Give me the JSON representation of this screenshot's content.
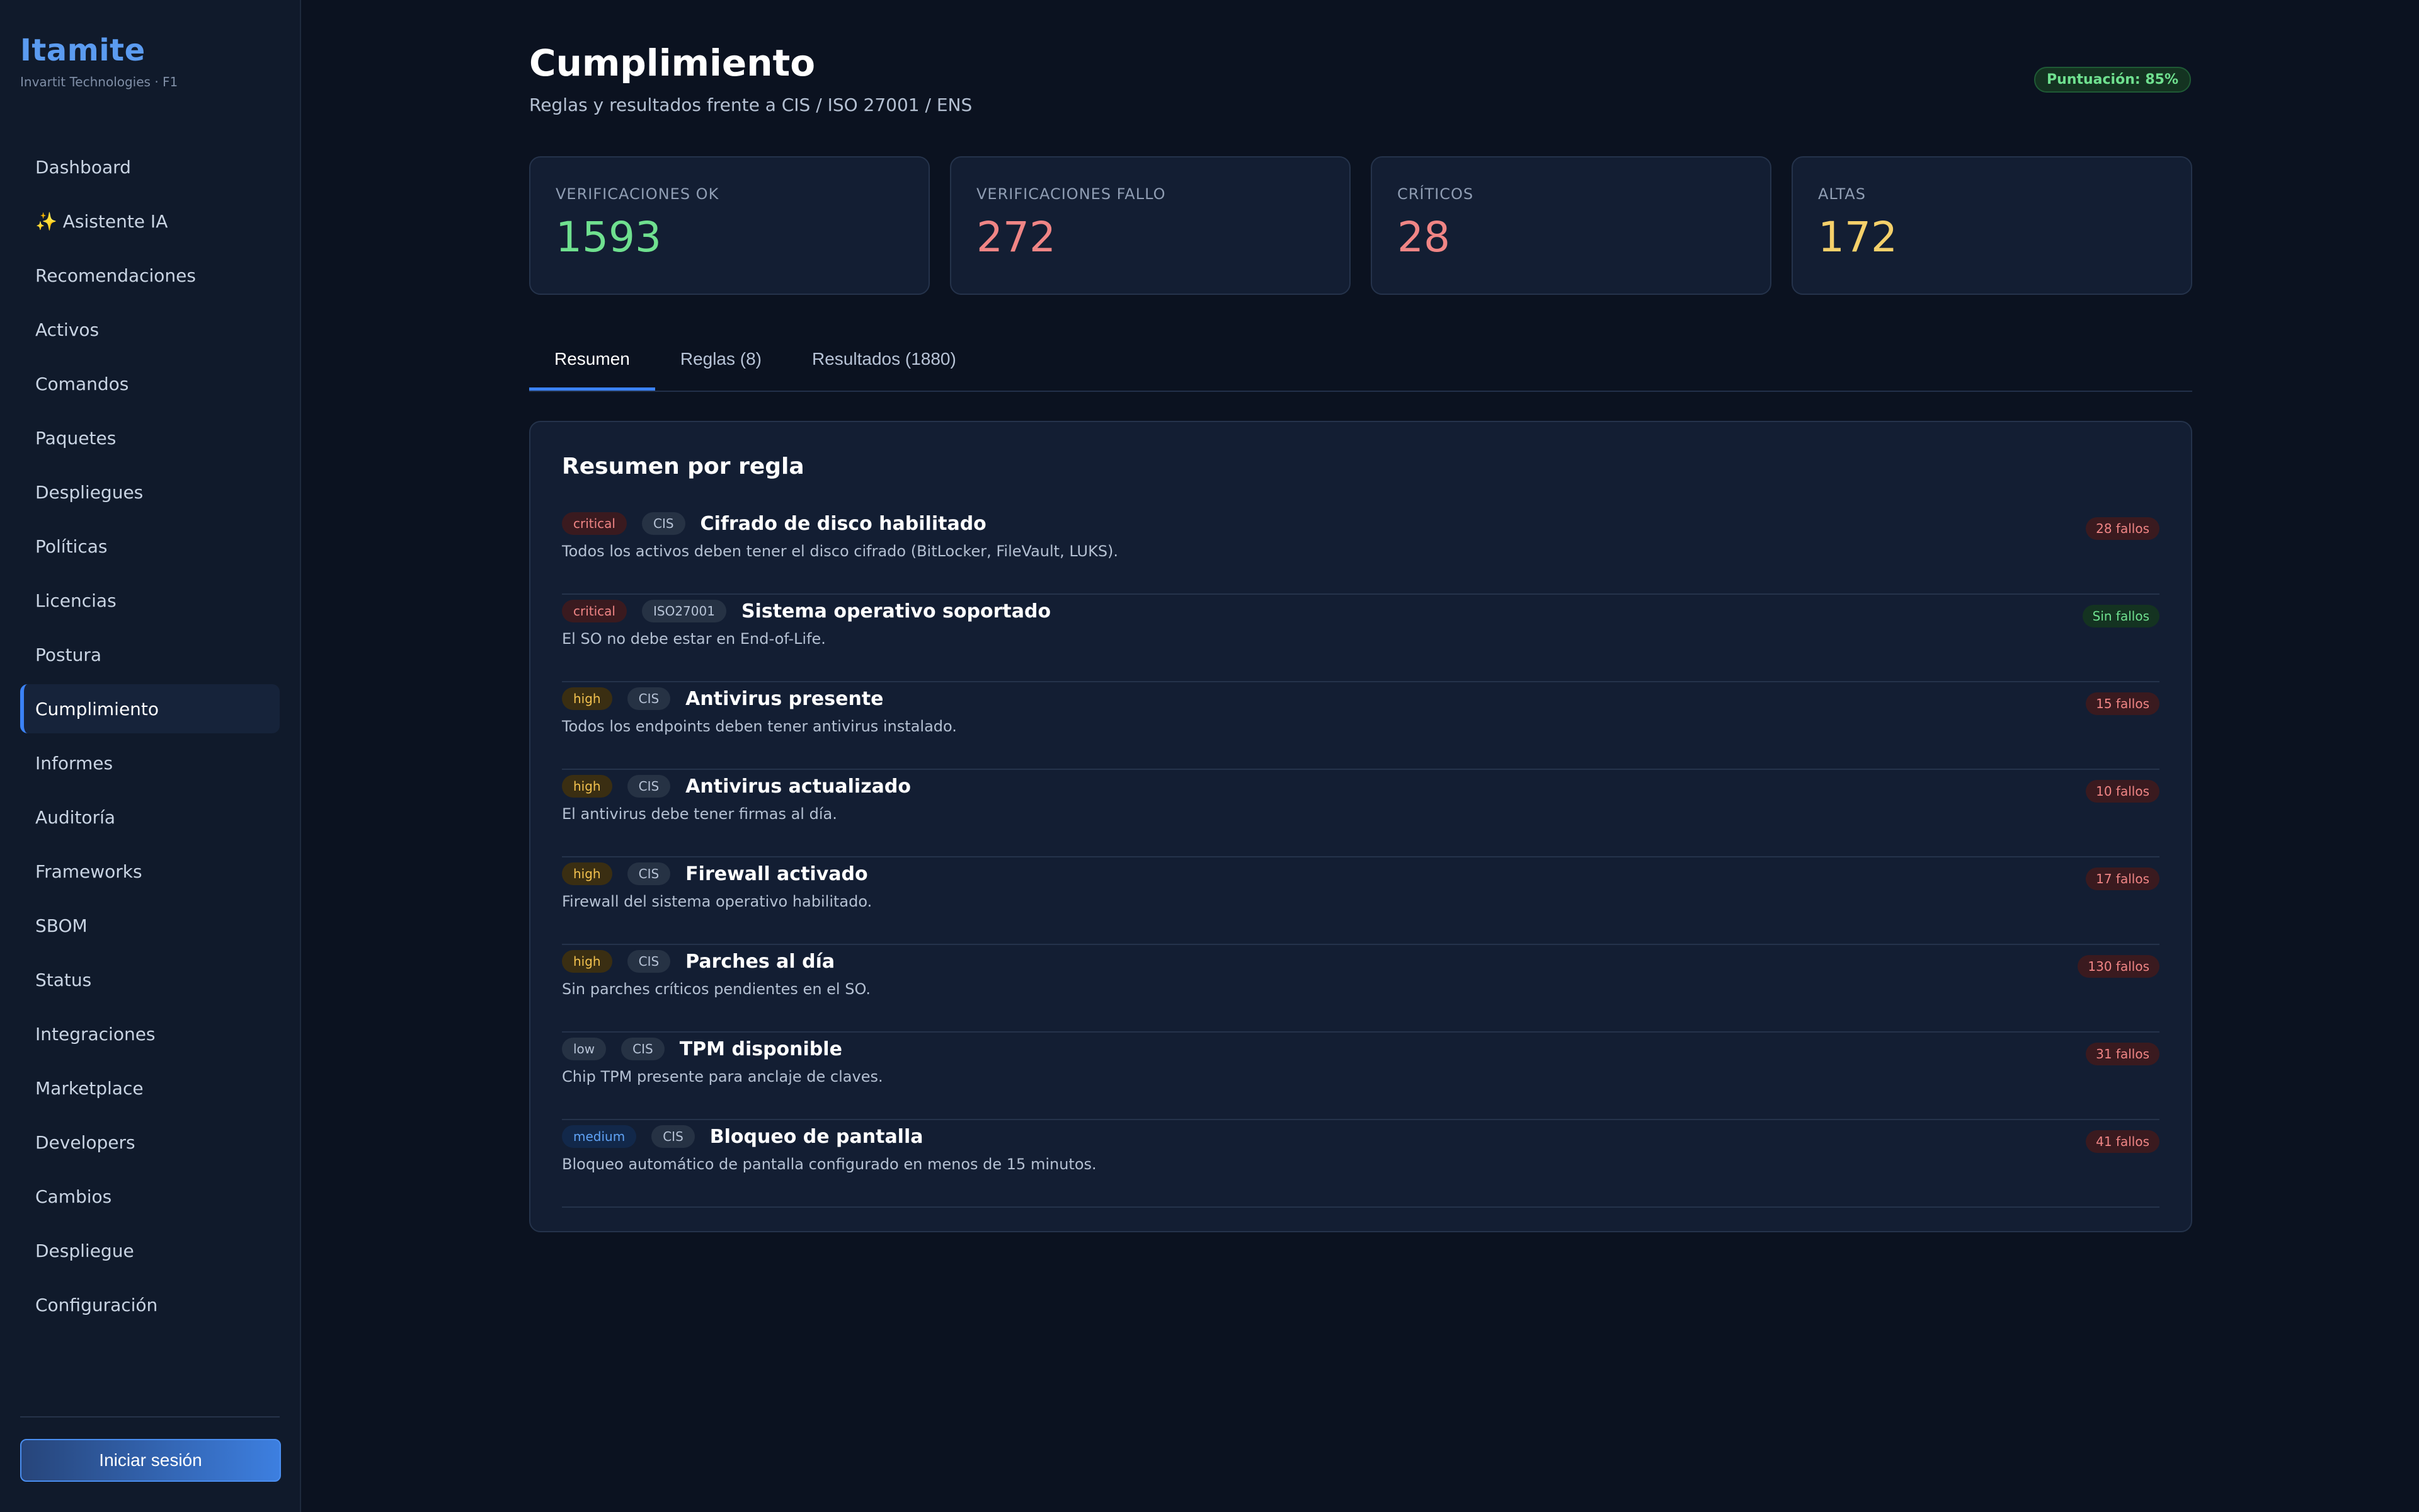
{
  "brand": {
    "title": "Itamite",
    "subtitle": "Invartit Technologies · F1"
  },
  "sidebar": {
    "items": [
      {
        "label": "Dashboard"
      },
      {
        "label": "✨ Asistente IA"
      },
      {
        "label": "Recomendaciones"
      },
      {
        "label": "Activos"
      },
      {
        "label": "Comandos"
      },
      {
        "label": "Paquetes"
      },
      {
        "label": "Despliegues"
      },
      {
        "label": "Políticas"
      },
      {
        "label": "Licencias"
      },
      {
        "label": "Postura"
      },
      {
        "label": "Cumplimiento"
      },
      {
        "label": "Informes"
      },
      {
        "label": "Auditoría"
      },
      {
        "label": "Frameworks"
      },
      {
        "label": "SBOM"
      },
      {
        "label": "Status"
      },
      {
        "label": "Integraciones"
      },
      {
        "label": "Marketplace"
      },
      {
        "label": "Developers"
      },
      {
        "label": "Cambios"
      },
      {
        "label": "Despliegue"
      },
      {
        "label": "Configuración"
      }
    ],
    "active_index": 10,
    "login_label": "Iniciar sesión"
  },
  "header": {
    "title": "Cumplimiento",
    "subtitle": "Reglas y resultados frente a CIS / ISO 27001 / ENS",
    "score": "Puntuación: 85%"
  },
  "stats": [
    {
      "label": "VERIFICACIONES OK",
      "value": "1593",
      "color": "#6fe08f"
    },
    {
      "label": "VERIFICACIONES FALLO",
      "value": "272",
      "color": "#f08585"
    },
    {
      "label": "CRÍTICOS",
      "value": "28",
      "color": "#f08585"
    },
    {
      "label": "ALTAS",
      "value": "172",
      "color": "#f5d06a"
    }
  ],
  "tabs": [
    {
      "label": "Resumen"
    },
    {
      "label": "Reglas (8)"
    },
    {
      "label": "Resultados (1880)"
    }
  ],
  "summary": {
    "title": "Resumen por regla",
    "rules": [
      {
        "severity": "critical",
        "framework": "CIS",
        "title": "Cifrado de disco habilitado",
        "description": "Todos los activos deben tener el disco cifrado (BitLocker, FileVault, LUKS).",
        "result": "28 fallos",
        "ok": false
      },
      {
        "severity": "critical",
        "framework": "ISO27001",
        "title": "Sistema operativo soportado",
        "description": "El SO no debe estar en End-of-Life.",
        "result": "Sin fallos",
        "ok": true
      },
      {
        "severity": "high",
        "framework": "CIS",
        "title": "Antivirus presente",
        "description": "Todos los endpoints deben tener antivirus instalado.",
        "result": "15 fallos",
        "ok": false
      },
      {
        "severity": "high",
        "framework": "CIS",
        "title": "Antivirus actualizado",
        "description": "El antivirus debe tener firmas al día.",
        "result": "10 fallos",
        "ok": false
      },
      {
        "severity": "high",
        "framework": "CIS",
        "title": "Firewall activado",
        "description": "Firewall del sistema operativo habilitado.",
        "result": "17 fallos",
        "ok": false
      },
      {
        "severity": "high",
        "framework": "CIS",
        "title": "Parches al día",
        "description": "Sin parches críticos pendientes en el SO.",
        "result": "130 fallos",
        "ok": false
      },
      {
        "severity": "low",
        "framework": "CIS",
        "title": "TPM disponible",
        "description": "Chip TPM presente para anclaje de claves.",
        "result": "31 fallos",
        "ok": false
      },
      {
        "severity": "medium",
        "framework": "CIS",
        "title": "Bloqueo de pantalla",
        "description": "Bloqueo automático de pantalla configurado en menos de 15 minutos.",
        "result": "41 fallos",
        "ok": false
      }
    ]
  }
}
